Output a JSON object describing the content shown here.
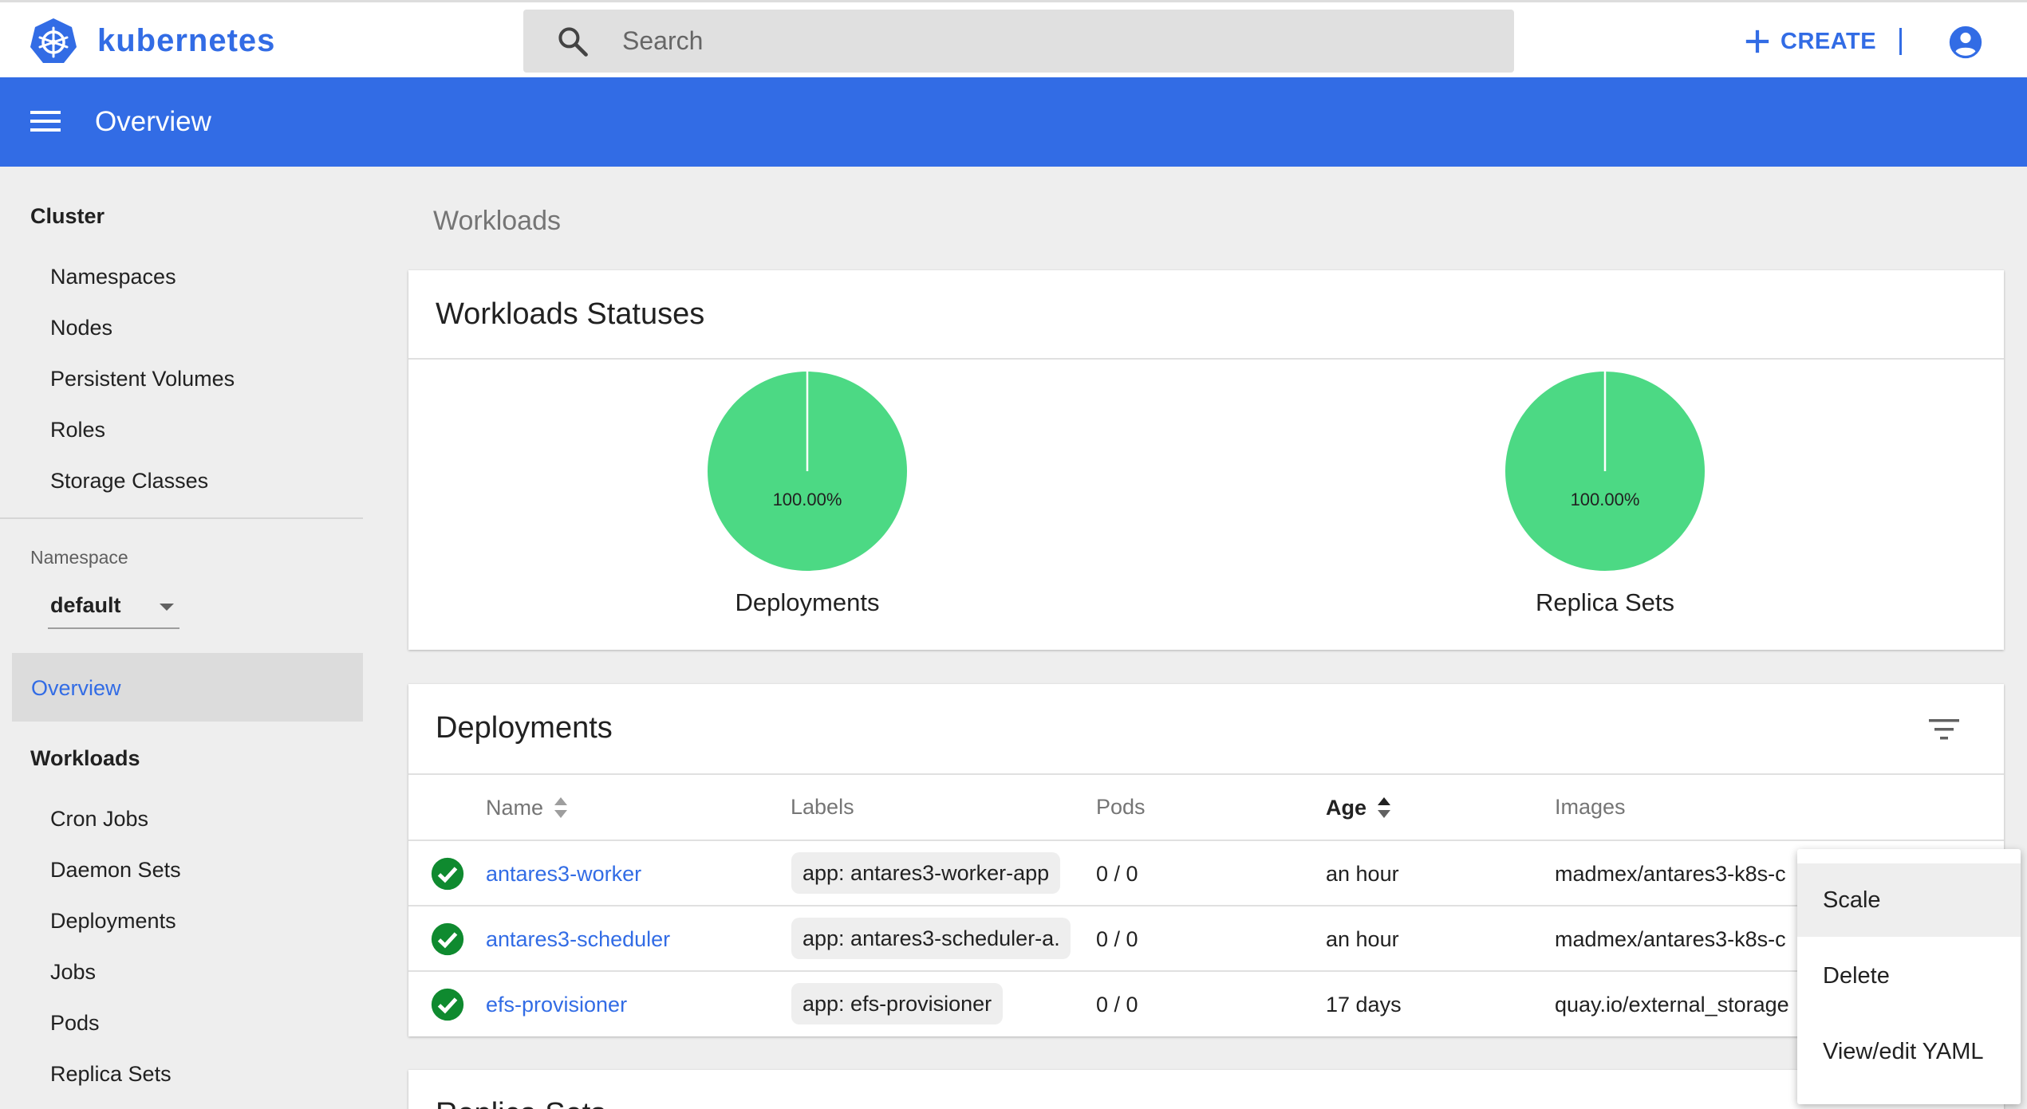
{
  "brand": {
    "name": "kubernetes"
  },
  "search": {
    "placeholder": "Search"
  },
  "topbar": {
    "create_label": "CREATE"
  },
  "toolbar": {
    "title": "Overview"
  },
  "sidebar": {
    "cluster_header": "Cluster",
    "cluster_items": [
      "Namespaces",
      "Nodes",
      "Persistent Volumes",
      "Roles",
      "Storage Classes"
    ],
    "namespace_label": "Namespace",
    "namespace_value": "default",
    "overview_label": "Overview",
    "workloads_header": "Workloads",
    "workload_items": [
      "Cron Jobs",
      "Daemon Sets",
      "Deployments",
      "Jobs",
      "Pods",
      "Replica Sets"
    ]
  },
  "main": {
    "heading": "Workloads",
    "statuses_card": {
      "title": "Workloads Statuses",
      "charts": [
        {
          "label": "Deployments",
          "percent_text": "100.00%",
          "value": 100
        },
        {
          "label": "Replica Sets",
          "percent_text": "100.00%",
          "value": 100
        }
      ]
    },
    "deployments_card": {
      "title": "Deployments",
      "columns": [
        "Name",
        "Labels",
        "Pods",
        "Age",
        "Images"
      ],
      "rows": [
        {
          "name": "antares3-worker",
          "label": "app: antares3-worker-app",
          "pods": "0 / 0",
          "age": "an hour",
          "image": "madmex/antares3-k8s-c"
        },
        {
          "name": "antares3-scheduler",
          "label": "app: antares3-scheduler-a.",
          "pods": "0 / 0",
          "age": "an hour",
          "image": "madmex/antares3-k8s-c"
        },
        {
          "name": "efs-provisioner",
          "label": "app: efs-provisioner",
          "pods": "0 / 0",
          "age": "17 days",
          "image": "quay.io/external_storage"
        }
      ]
    },
    "next_card": {
      "title": "Replica Sets"
    }
  },
  "context_menu": {
    "items": [
      "Scale",
      "Delete",
      "View/edit YAML"
    ]
  },
  "colors": {
    "brand_blue": "#326ce5",
    "chart_green": "#4cd984",
    "status_green": "#0f8a2f"
  }
}
